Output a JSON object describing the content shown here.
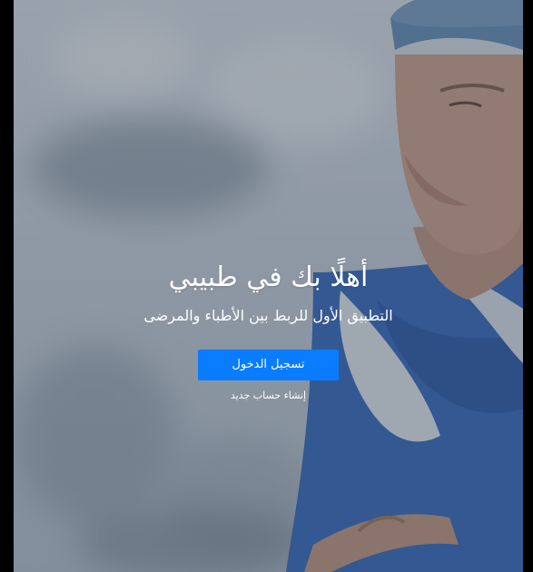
{
  "hero": {
    "title": "أهلًا بك في طبيبي",
    "subtitle": "التطبيق الأول للربط بين الأطباء والمرضى",
    "login_label": "تسجيل الدخول",
    "signup_label": "إنشاء حساب جديد"
  },
  "colors": {
    "primary_button": "#0a7cff",
    "scrubs": "#3b6fc4",
    "overlay": "#283444"
  },
  "background_image": "doctor-in-surgical-scrubs"
}
